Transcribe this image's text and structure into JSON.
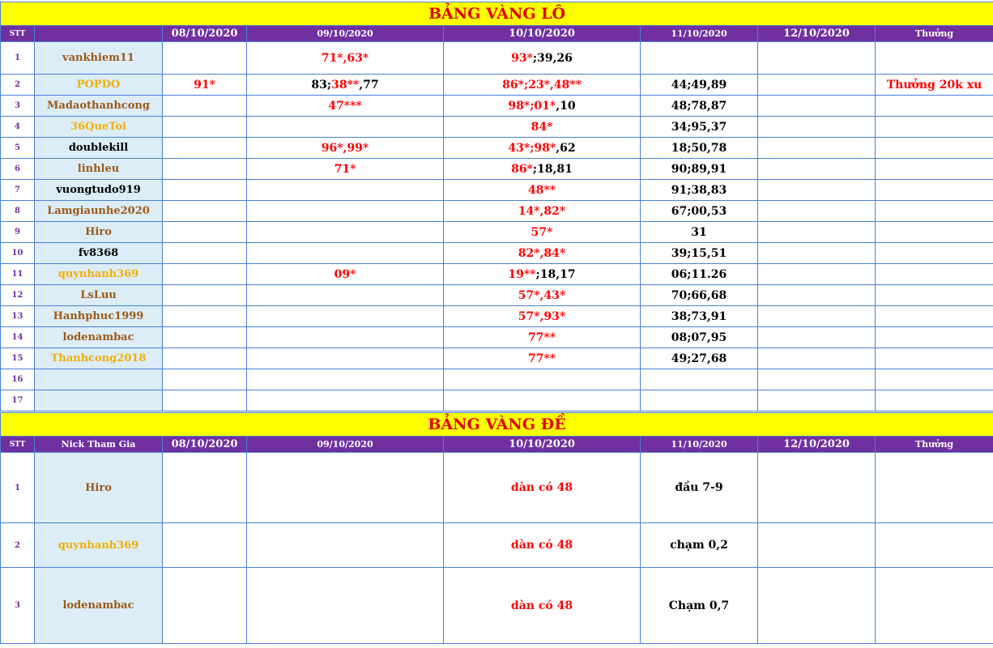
{
  "lo": {
    "title": "BẢNG VÀNG LÔ",
    "headers": {
      "stt": "STT",
      "nick": "",
      "d1": "08/10/2020",
      "d2": "09/10/2020",
      "d3": "10/10/2020",
      "d4": "11/10/2020",
      "d5": "12/10/2020",
      "reward": "Thưởng"
    },
    "rows": [
      {
        "stt": "1",
        "nick": "vankhiem11",
        "nick_color": "brown",
        "d1": [],
        "d2": [
          {
            "t": "71*,63*",
            "c": "red"
          }
        ],
        "d3": [
          {
            "t": "93*",
            "c": "red"
          },
          {
            "t": ";39,26",
            "c": "black"
          }
        ],
        "d4": [],
        "d5": [],
        "reward": []
      },
      {
        "stt": "2",
        "nick": "POPDO",
        "nick_color": "gold",
        "d1": [
          {
            "t": "91*",
            "c": "red"
          }
        ],
        "d2": [
          {
            "t": "83;",
            "c": "black"
          },
          {
            "t": "38**",
            "c": "red"
          },
          {
            "t": ",77",
            "c": "black"
          }
        ],
        "d3": [
          {
            "t": "86*;23*,48**",
            "c": "red"
          }
        ],
        "d4": [
          {
            "t": "44;49,89",
            "c": "black"
          }
        ],
        "d5": [],
        "reward": [
          {
            "t": "Thưởng 20k xu",
            "c": "red"
          }
        ]
      },
      {
        "stt": "3",
        "nick": "Madaothanhcong",
        "nick_color": "brown",
        "d1": [],
        "d2": [
          {
            "t": "47***",
            "c": "red"
          }
        ],
        "d3": [
          {
            "t": "98*;01*",
            "c": "red"
          },
          {
            "t": ",10",
            "c": "black"
          }
        ],
        "d4": [
          {
            "t": "48;78,87",
            "c": "black"
          }
        ],
        "d5": [],
        "reward": []
      },
      {
        "stt": "4",
        "nick": "36QueToi",
        "nick_color": "gold",
        "d1": [],
        "d2": [],
        "d3": [
          {
            "t": "84*",
            "c": "red"
          }
        ],
        "d4": [
          {
            "t": "34;95,37",
            "c": "black"
          }
        ],
        "d5": [],
        "reward": []
      },
      {
        "stt": "5",
        "nick": "doublekill",
        "nick_color": "black",
        "d1": [],
        "d2": [
          {
            "t": "96*,99*",
            "c": "red"
          }
        ],
        "d3": [
          {
            "t": "43*;98*",
            "c": "red"
          },
          {
            "t": ",62",
            "c": "black"
          }
        ],
        "d4": [
          {
            "t": "18;50,78",
            "c": "black"
          }
        ],
        "d5": [],
        "reward": []
      },
      {
        "stt": "6",
        "nick": "linhleu",
        "nick_color": "brown",
        "d1": [],
        "d2": [
          {
            "t": "71*",
            "c": "red"
          }
        ],
        "d3": [
          {
            "t": "86*",
            "c": "red"
          },
          {
            "t": ";18,81",
            "c": "black"
          }
        ],
        "d4": [
          {
            "t": "90;89,91",
            "c": "black"
          }
        ],
        "d5": [],
        "reward": []
      },
      {
        "stt": "7",
        "nick": "vuongtudo919",
        "nick_color": "black",
        "d1": [],
        "d2": [],
        "d3": [
          {
            "t": "48**",
            "c": "red"
          }
        ],
        "d4": [
          {
            "t": "91;38,83",
            "c": "black"
          }
        ],
        "d5": [],
        "reward": []
      },
      {
        "stt": "8",
        "nick": "Lamgiaunhe2020",
        "nick_color": "brown",
        "d1": [],
        "d2": [],
        "d3": [
          {
            "t": "14*,82*",
            "c": "red"
          }
        ],
        "d4": [
          {
            "t": "67;00,53",
            "c": "black"
          }
        ],
        "d5": [],
        "reward": []
      },
      {
        "stt": "9",
        "nick": "Hiro",
        "nick_color": "brown",
        "d1": [],
        "d2": [],
        "d3": [
          {
            "t": "57*",
            "c": "red"
          }
        ],
        "d4": [
          {
            "t": "31",
            "c": "black"
          }
        ],
        "d5": [],
        "reward": []
      },
      {
        "stt": "10",
        "nick": "fv8368",
        "nick_color": "black",
        "d1": [],
        "d2": [],
        "d3": [
          {
            "t": "82*,84*",
            "c": "red"
          }
        ],
        "d4": [
          {
            "t": "39;15,51",
            "c": "black"
          }
        ],
        "d5": [],
        "reward": []
      },
      {
        "stt": "11",
        "nick": "quynhanh369",
        "nick_color": "gold",
        "d1": [],
        "d2": [
          {
            "t": "09*",
            "c": "red"
          }
        ],
        "d3": [
          {
            "t": "19**",
            "c": "red"
          },
          {
            "t": ";18,17",
            "c": "black"
          }
        ],
        "d4": [
          {
            "t": "06;11.26",
            "c": "black"
          }
        ],
        "d5": [],
        "reward": []
      },
      {
        "stt": "12",
        "nick": "LsLuu",
        "nick_color": "brown",
        "d1": [],
        "d2": [],
        "d3": [
          {
            "t": "57*,43*",
            "c": "red"
          }
        ],
        "d4": [
          {
            "t": "70;66,68",
            "c": "black"
          }
        ],
        "d5": [],
        "reward": []
      },
      {
        "stt": "13",
        "nick": "Hanhphuc1999",
        "nick_color": "brown",
        "d1": [],
        "d2": [],
        "d3": [
          {
            "t": "57*,93*",
            "c": "red"
          }
        ],
        "d4": [
          {
            "t": "38;73,91",
            "c": "black"
          }
        ],
        "d5": [],
        "reward": []
      },
      {
        "stt": "14",
        "nick": "lodenambac",
        "nick_color": "brown",
        "d1": [],
        "d2": [],
        "d3": [
          {
            "t": "77**",
            "c": "red"
          }
        ],
        "d4": [
          {
            "t": "08;07,95",
            "c": "black"
          }
        ],
        "d5": [],
        "reward": []
      },
      {
        "stt": "15",
        "nick": "Thanhcong2018",
        "nick_color": "gold",
        "d1": [],
        "d2": [],
        "d3": [
          {
            "t": "77**",
            "c": "red"
          }
        ],
        "d4": [
          {
            "t": "49;27,68",
            "c": "black"
          }
        ],
        "d5": [],
        "reward": []
      },
      {
        "stt": "16",
        "nick": "",
        "nick_color": "black",
        "d1": [],
        "d2": [],
        "d3": [],
        "d4": [],
        "d5": [],
        "reward": []
      },
      {
        "stt": "17",
        "nick": "",
        "nick_color": "black",
        "d1": [],
        "d2": [],
        "d3": [],
        "d4": [],
        "d5": [],
        "reward": []
      }
    ]
  },
  "de": {
    "title": "BẢNG VÀNG ĐỀ",
    "headers": {
      "stt": "STT",
      "nick": "Nick Tham Gia",
      "d1": "08/10/2020",
      "d2": "09/10/2020",
      "d3": "10/10/2020",
      "d4": "11/10/2020",
      "d5": "12/10/2020",
      "reward": "Thưởng"
    },
    "rows": [
      {
        "stt": "1",
        "nick": "Hiro",
        "nick_color": "brown",
        "d1": [],
        "d2": [],
        "d3": [
          {
            "t": "dàn có 48",
            "c": "red"
          }
        ],
        "d4": [
          {
            "t": "đầu 7-9",
            "c": "black"
          }
        ],
        "d5": [],
        "reward": []
      },
      {
        "stt": "2",
        "nick": "quynhanh369",
        "nick_color": "gold",
        "d1": [],
        "d2": [],
        "d3": [
          {
            "t": "dàn có 48",
            "c": "red"
          }
        ],
        "d4": [
          {
            "t": "chạm 0,2",
            "c": "black"
          }
        ],
        "d5": [],
        "reward": []
      },
      {
        "stt": "3",
        "nick": "lodenambac",
        "nick_color": "brown",
        "d1": [],
        "d2": [],
        "d3": [
          {
            "t": "dàn có 48",
            "c": "red"
          }
        ],
        "d4": [
          {
            "t": "Chạm 0,7",
            "c": "black"
          }
        ],
        "d5": [],
        "reward": []
      }
    ]
  },
  "colors": {
    "title_bg": "#ffff00",
    "title_text": "#e00000",
    "header_bg": "#7030a0",
    "grid": "#4a7fd8",
    "nick_bg": "#dcedf7",
    "brown": "#9c5a16",
    "gold": "#f0b000",
    "red": "#ff0000"
  }
}
